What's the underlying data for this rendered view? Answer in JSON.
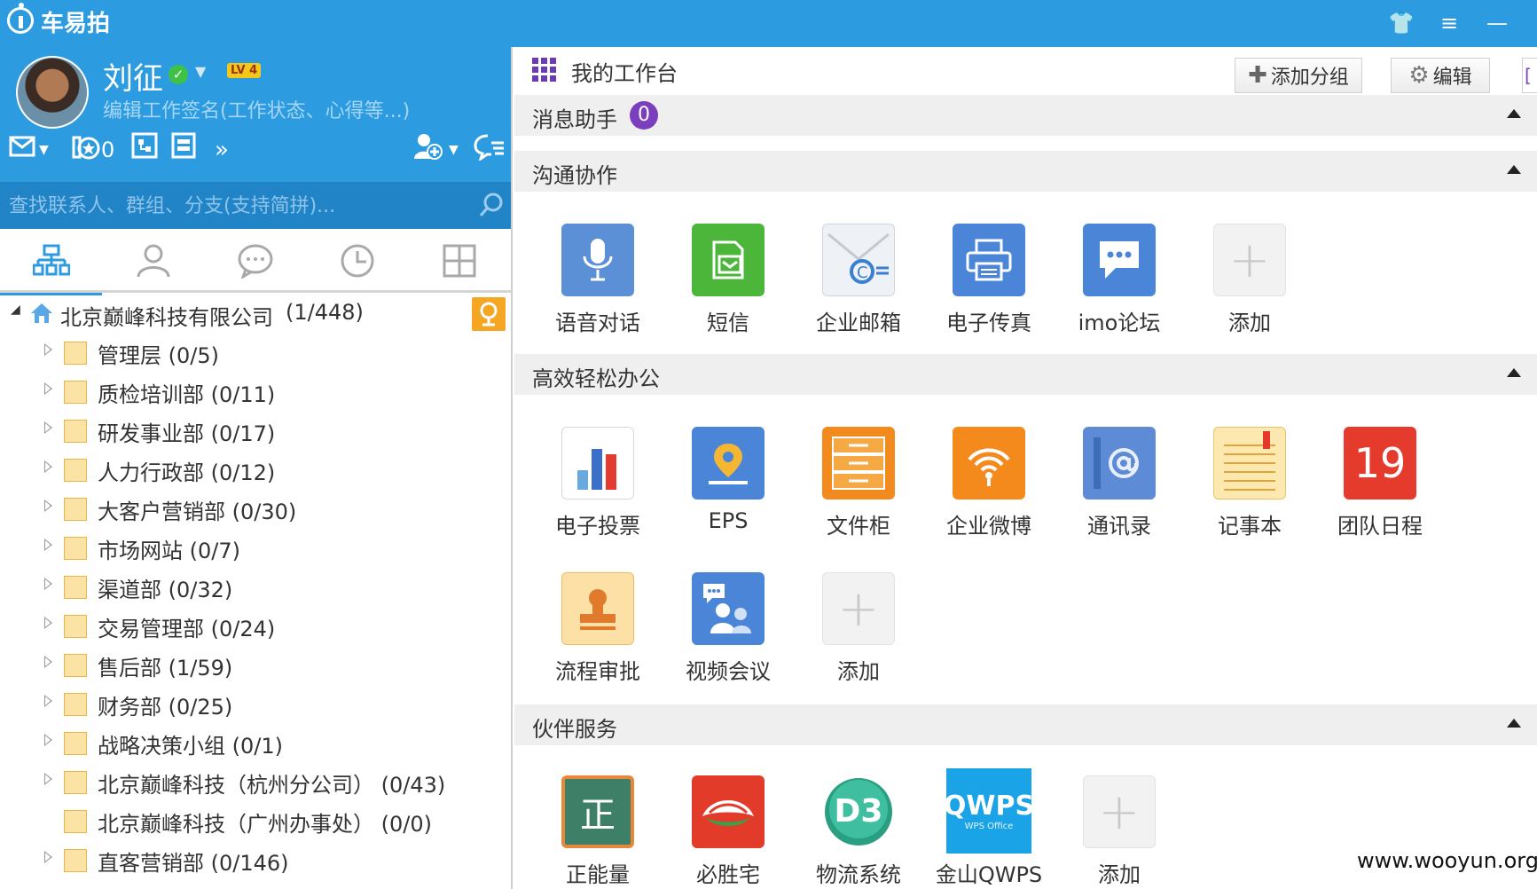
{
  "app": {
    "title": "车易拍"
  },
  "window_controls": {
    "skin": "👕",
    "menu": "≡",
    "minimize": "—"
  },
  "user": {
    "name": "刘征",
    "status_check": "✓",
    "level": "LV 4",
    "signature": "编辑工作签名(工作状态、心得等...)",
    "activity_count": "0"
  },
  "search": {
    "placeholder": "查找联系人、群组、分支(支持简拼)..."
  },
  "tree": {
    "root": {
      "label": "北京巅峰科技有限公司",
      "count": "(1/448)"
    },
    "items": [
      {
        "label": "管理层  (0/5)",
        "expandable": true
      },
      {
        "label": "质检培训部  (0/11)",
        "expandable": true
      },
      {
        "label": "研发事业部  (0/17)",
        "expandable": true
      },
      {
        "label": "人力行政部  (0/12)",
        "expandable": true
      },
      {
        "label": "大客户营销部  (0/30)",
        "expandable": true
      },
      {
        "label": "市场网站  (0/7)",
        "expandable": true
      },
      {
        "label": "渠道部  (0/32)",
        "expandable": true
      },
      {
        "label": "交易管理部  (0/24)",
        "expandable": true
      },
      {
        "label": "售后部  (1/59)",
        "expandable": true
      },
      {
        "label": "财务部  (0/25)",
        "expandable": true
      },
      {
        "label": "战略决策小组  (0/1)",
        "expandable": true
      },
      {
        "label": "北京巅峰科技（杭州分公司）  (0/43)",
        "expandable": true
      },
      {
        "label": "北京巅峰科技（广州办事处）  (0/0)",
        "expandable": false
      },
      {
        "label": "直客营销部  (0/146)",
        "expandable": true
      }
    ]
  },
  "workbench": {
    "title": "我的工作台",
    "add_group": "添加分组",
    "edit": "编辑",
    "sections": {
      "messages": {
        "title": "消息助手",
        "count": "0"
      },
      "communication": {
        "title": "沟通协作",
        "apps": [
          "语音对话",
          "短信",
          "企业邮箱",
          "电子传真",
          "imo论坛",
          "添加"
        ]
      },
      "office": {
        "title": "高效轻松办公",
        "apps": [
          "电子投票",
          "EPS",
          "文件柜",
          "企业微博",
          "通讯录",
          "记事本",
          "团队日程",
          "流程审批",
          "视频会议",
          "添加"
        ],
        "calendar_day": "19"
      },
      "partners": {
        "title": "伙伴服务",
        "apps": [
          "正能量",
          "必胜宅",
          "物流系统",
          "金山QWPS",
          "添加"
        ],
        "zheng_glyph": "正",
        "d3_glyph": "D3",
        "wps_text": "QWPS",
        "wps_sub": "WPS Office"
      }
    }
  },
  "watermark": "www.wooyun.org",
  "colors": {
    "titlebar": "#2c9be0",
    "search": "#2184c7",
    "accent_orange": "#f5a623",
    "badge_purple": "#7b3fbd"
  }
}
